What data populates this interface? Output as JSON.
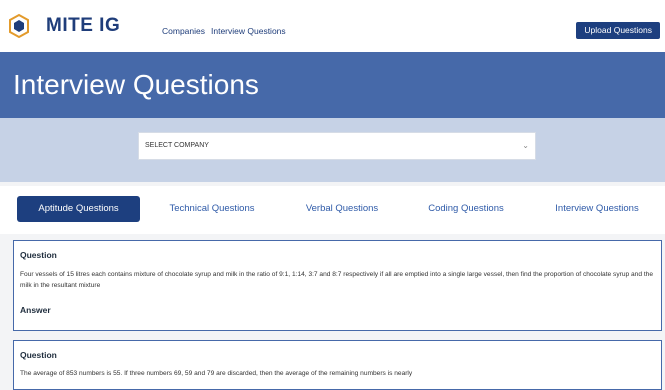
{
  "header": {
    "brand": "MITE IG",
    "nav": [
      "Companies",
      "Interview Questions"
    ],
    "upload_label": "Upload Questions"
  },
  "hero": {
    "title": "Interview Questions"
  },
  "company_select": {
    "value": "SELECT COMPANY"
  },
  "tabs": [
    {
      "label": "Aptitude Questions",
      "active": true
    },
    {
      "label": "Technical Questions",
      "active": false
    },
    {
      "label": "Verbal Questions",
      "active": false
    },
    {
      "label": "Coding Questions",
      "active": false
    },
    {
      "label": "Interview Questions",
      "active": false
    }
  ],
  "questions": [
    {
      "question_label": "Question",
      "text": "Four vessels of 15 litres each contains mixture of chocolate syrup and milk in the ratio of 9:1, 1:14, 3:7 and 8:7 respectively if all are emptied into a single large vessel, then find the proportion of chocolate syrup and the milk in the resultant mixture",
      "answer_label": "Answer"
    },
    {
      "question_label": "Question",
      "text": "The average of 853 numbers is 55. If three numbers 69, 59 and 79 are discarded, then the average of the remaining numbers is nearly"
    }
  ],
  "colors": {
    "primary": "#1d3f7f",
    "hero": "#4669a9",
    "band": "#c6d2e6"
  }
}
